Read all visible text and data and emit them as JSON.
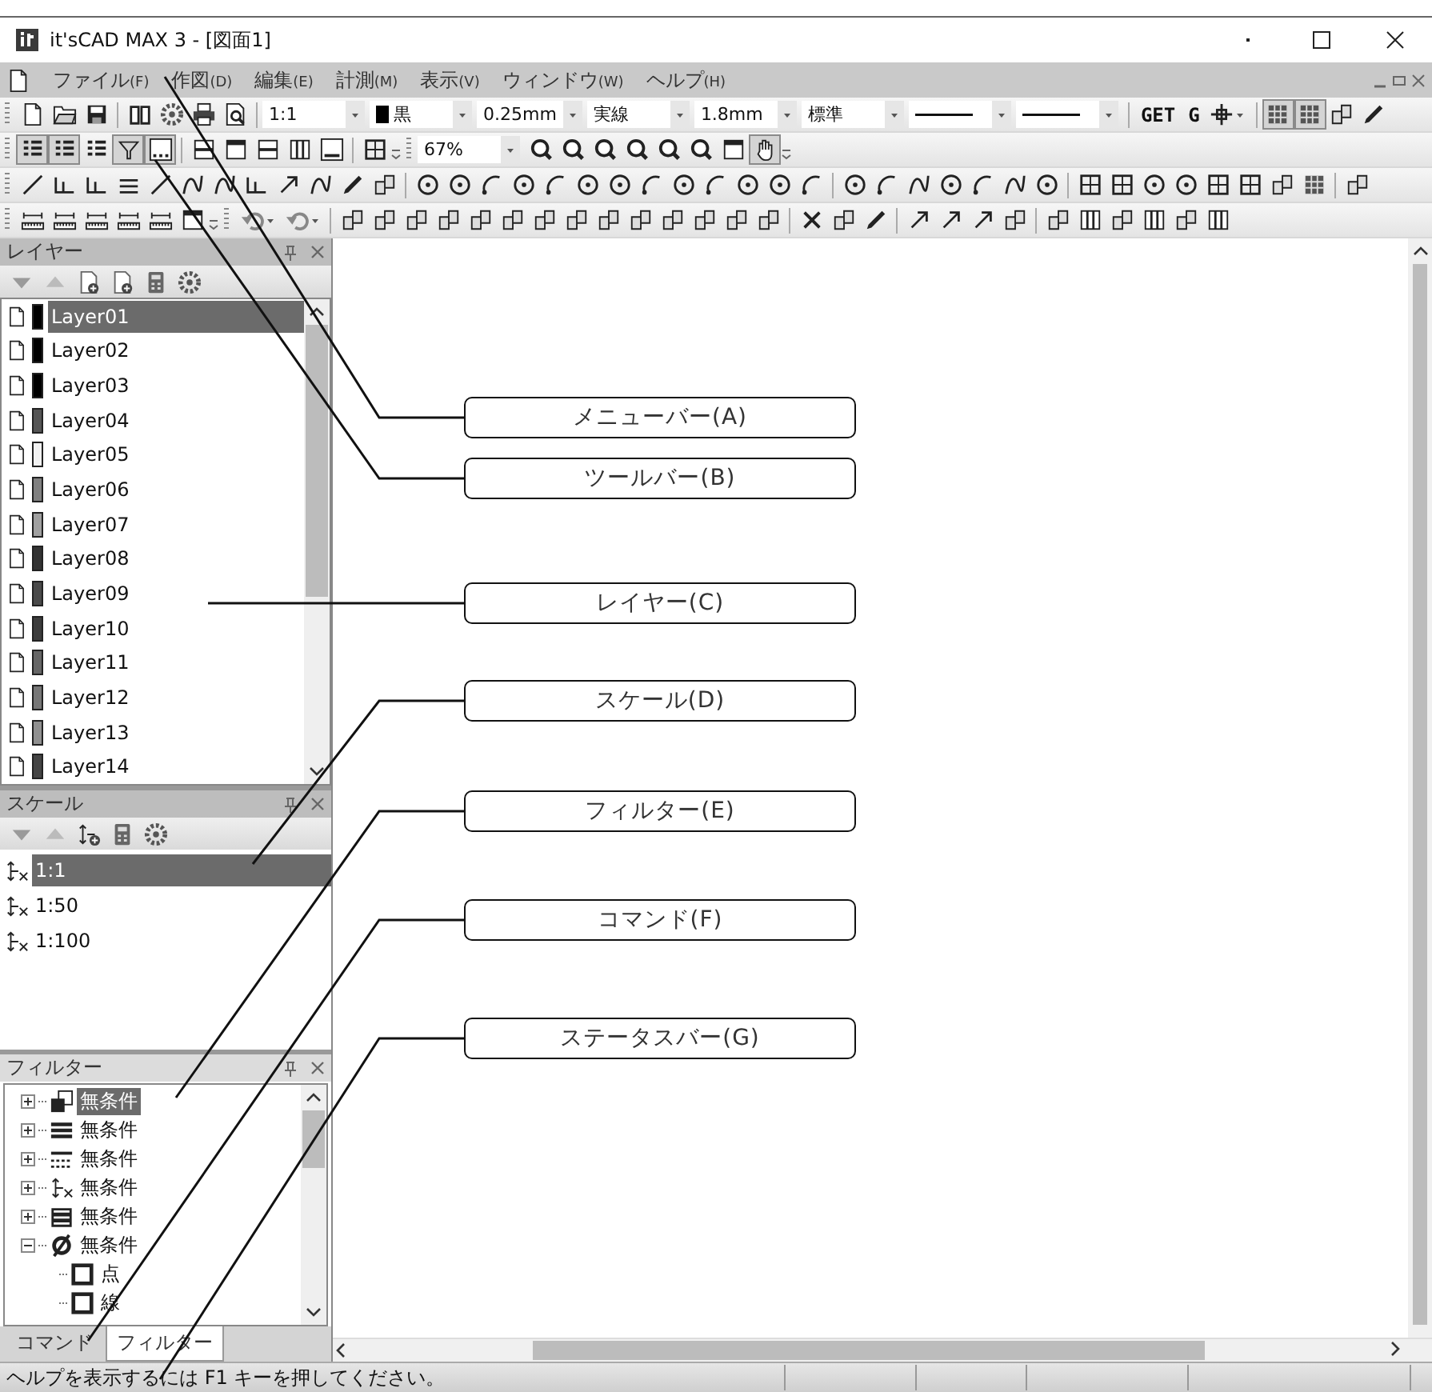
{
  "window": {
    "title": "it'sCAD MAX 3 - [図面1]"
  },
  "menu": [
    {
      "label": "ファイル",
      "key": "(F)"
    },
    {
      "label": "作図",
      "key": "(D)"
    },
    {
      "label": "編集",
      "key": "(E)"
    },
    {
      "label": "計測",
      "key": "(M)"
    },
    {
      "label": "表示",
      "key": "(V)"
    },
    {
      "label": "ウィンドウ",
      "key": "(W)"
    },
    {
      "label": "ヘルプ",
      "key": "(H)"
    }
  ],
  "toolbars": [
    {
      "items": [
        {
          "kind": "buttons",
          "pressed": [
            false,
            false,
            false
          ]
        },
        {
          "kind": "separator"
        },
        {
          "kind": "buttons",
          "pressed": [
            false,
            false,
            false,
            false
          ]
        },
        {
          "kind": "separator"
        },
        {
          "kind": "combo",
          "value": "1:1"
        },
        {
          "kind": "color-combo",
          "value": "黒"
        },
        {
          "kind": "combo",
          "value": "0.25mm"
        },
        {
          "kind": "combo",
          "value": "実線"
        },
        {
          "kind": "combo",
          "value": "1.8mm"
        },
        {
          "kind": "combo",
          "value": "標準"
        },
        {
          "kind": "line-combo"
        },
        {
          "kind": "line-combo"
        },
        {
          "kind": "separator"
        },
        {
          "kind": "label",
          "text": "GET"
        },
        {
          "kind": "label",
          "text": "G"
        },
        {
          "kind": "dropdown-button"
        },
        {
          "kind": "separator"
        },
        {
          "kind": "buttons",
          "pressed": [
            true,
            true,
            false,
            false
          ]
        }
      ]
    },
    {
      "items": [
        {
          "kind": "buttons",
          "pressed": [
            true,
            true,
            false,
            true,
            true
          ]
        },
        {
          "kind": "separator"
        },
        {
          "kind": "buttons",
          "pressed": [
            false,
            false,
            false,
            false,
            false
          ]
        },
        {
          "kind": "separator"
        },
        {
          "kind": "buttons",
          "pressed": [
            false
          ]
        },
        {
          "kind": "overflow"
        },
        {
          "kind": "grip"
        },
        {
          "kind": "combo",
          "value": "67%"
        },
        {
          "kind": "buttons",
          "pressed": [
            false,
            false,
            false,
            false,
            false,
            false,
            false,
            true
          ]
        },
        {
          "kind": "overflow"
        }
      ]
    },
    {
      "items": [
        {
          "kind": "buttons",
          "pressed": [
            false,
            false,
            false,
            false,
            false,
            false,
            false,
            false,
            false,
            false,
            false,
            false
          ]
        },
        {
          "kind": "separator"
        },
        {
          "kind": "buttons",
          "pressed": [
            false,
            false,
            false,
            false,
            false,
            false,
            false,
            false,
            false,
            false,
            false,
            false,
            false
          ]
        },
        {
          "kind": "separator"
        },
        {
          "kind": "buttons",
          "pressed": [
            false,
            false,
            false,
            false,
            false,
            false,
            false
          ]
        },
        {
          "kind": "separator"
        },
        {
          "kind": "buttons",
          "pressed": [
            false,
            false,
            false,
            false,
            false,
            false,
            false,
            false
          ]
        },
        {
          "kind": "separator"
        },
        {
          "kind": "buttons",
          "pressed": [
            false
          ]
        }
      ]
    },
    {
      "items": [
        {
          "kind": "buttons",
          "pressed": [
            false,
            false,
            false,
            false,
            false,
            false
          ]
        },
        {
          "kind": "overflow"
        },
        {
          "kind": "grip"
        },
        {
          "kind": "dropdown-button"
        },
        {
          "kind": "dropdown-button"
        },
        {
          "kind": "separator"
        },
        {
          "kind": "buttons",
          "pressed": [
            false,
            false,
            false,
            false,
            false,
            false,
            false,
            false,
            false,
            false,
            false,
            false,
            false,
            false
          ]
        },
        {
          "kind": "separator"
        },
        {
          "kind": "buttons",
          "pressed": [
            false,
            false,
            false
          ]
        },
        {
          "kind": "separator"
        },
        {
          "kind": "buttons",
          "pressed": [
            false,
            false,
            false,
            false
          ]
        },
        {
          "kind": "separator"
        },
        {
          "kind": "buttons",
          "pressed": [
            false,
            false,
            false,
            false,
            false,
            false
          ]
        }
      ]
    }
  ],
  "layers": {
    "title": "レイヤー",
    "items": [
      {
        "name": "Layer01",
        "color": "#000000",
        "selected": true
      },
      {
        "name": "Layer02",
        "color": "#000000",
        "selected": false
      },
      {
        "name": "Layer03",
        "color": "#000000",
        "selected": false
      },
      {
        "name": "Layer04",
        "color": "#555555",
        "selected": false
      },
      {
        "name": "Layer05",
        "color": "#f2f2f2",
        "selected": false
      },
      {
        "name": "Layer06",
        "color": "#808080",
        "selected": false
      },
      {
        "name": "Layer07",
        "color": "#a0a0a0",
        "selected": false
      },
      {
        "name": "Layer08",
        "color": "#333333",
        "selected": false
      },
      {
        "name": "Layer09",
        "color": "#4a4a4a",
        "selected": false
      },
      {
        "name": "Layer10",
        "color": "#3c3c3c",
        "selected": false
      },
      {
        "name": "Layer11",
        "color": "#666666",
        "selected": false
      },
      {
        "name": "Layer12",
        "color": "#777777",
        "selected": false
      },
      {
        "name": "Layer13",
        "color": "#909090",
        "selected": false
      },
      {
        "name": "Layer14",
        "color": "#444444",
        "selected": false
      }
    ]
  },
  "scales": {
    "title": "スケール",
    "items": [
      {
        "label": "1:1",
        "selected": true
      },
      {
        "label": "1:50",
        "selected": false
      },
      {
        "label": "1:100",
        "selected": false
      }
    ]
  },
  "filter": {
    "title": "フィルター",
    "items": [
      {
        "label": "無条件",
        "expanded": false,
        "selected": true
      },
      {
        "label": "無条件",
        "expanded": false,
        "selected": false
      },
      {
        "label": "無条件",
        "expanded": false,
        "selected": false
      },
      {
        "label": "無条件",
        "expanded": false,
        "selected": false
      },
      {
        "label": "無条件",
        "expanded": false,
        "selected": false
      },
      {
        "label": "無条件",
        "expanded": true,
        "selected": false,
        "children": [
          {
            "label": "点"
          },
          {
            "label": "線"
          }
        ]
      }
    ]
  },
  "bottom_tabs": [
    {
      "label": "コマンド",
      "selected": false
    },
    {
      "label": "フィルター",
      "selected": true
    }
  ],
  "status_bar": {
    "text": "ヘルプを表示するには F1 キーを押してください。"
  },
  "callouts": [
    {
      "label": "メニューバー(A)"
    },
    {
      "label": "ツールバー(B)"
    },
    {
      "label": "レイヤー(C)"
    },
    {
      "label": "スケール(D)"
    },
    {
      "label": "フィルター(E)"
    },
    {
      "label": "コマンド(F)"
    },
    {
      "label": "ステータスバー(G)"
    }
  ]
}
